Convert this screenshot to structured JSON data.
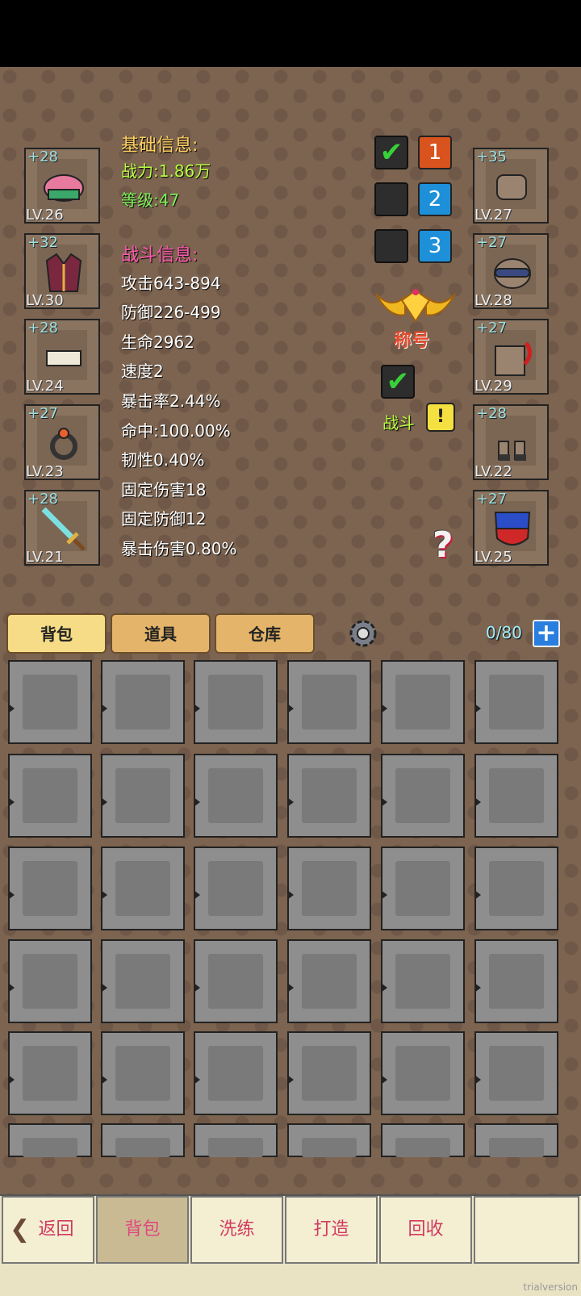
{
  "left_equipment": [
    {
      "plus": "+28",
      "level": "LV.26",
      "item_icon": "helmet-icon"
    },
    {
      "plus": "+32",
      "level": "LV.30",
      "item_icon": "armor-icon"
    },
    {
      "plus": "+28",
      "level": "LV.24",
      "item_icon": "skirt-icon"
    },
    {
      "plus": "+27",
      "level": "LV.23",
      "item_icon": "ring-icon"
    },
    {
      "plus": "+28",
      "level": "LV.21",
      "item_icon": "sword-icon"
    }
  ],
  "right_equipment": [
    {
      "plus": "+35",
      "level": "LV.27",
      "item_icon": "gloves-icon"
    },
    {
      "plus": "+27",
      "level": "LV.28",
      "item_icon": "mask-icon"
    },
    {
      "plus": "+27",
      "level": "LV.29",
      "item_icon": "cape-icon"
    },
    {
      "plus": "+28",
      "level": "LV.22",
      "item_icon": "boots-icon"
    },
    {
      "plus": "+27",
      "level": "LV.25",
      "item_icon": "shield-icon"
    }
  ],
  "basic_info": {
    "header": "基础信息:",
    "power": "战力:1.86万",
    "level": "等级:47"
  },
  "battle_info": {
    "header": "战斗信息:",
    "stats": [
      "攻击643-894",
      "防御226-499",
      "生命2962",
      "速度2",
      "暴击率2.44%",
      "命中:100.00%",
      "韧性0.40%",
      "固定伤害18",
      "固定防御12",
      "暴击伤害0.80%"
    ]
  },
  "presets": [
    {
      "number": "1",
      "checked": true,
      "color": "#d9531e"
    },
    {
      "number": "2",
      "checked": false,
      "color": "#1e90d9"
    },
    {
      "number": "3",
      "checked": false,
      "color": "#1e90d9"
    }
  ],
  "title_badge": {
    "label": "称号"
  },
  "battle_toggle": {
    "label": "战斗",
    "checked": true,
    "alert": "!"
  },
  "help_icon": "?",
  "tabs": [
    {
      "label": "背包",
      "active": true
    },
    {
      "label": "道具",
      "active": false
    },
    {
      "label": "仓库",
      "active": false
    }
  ],
  "capacity": "0/80",
  "bottom_nav": [
    {
      "label": "返回"
    },
    {
      "label": "背包",
      "active": true
    },
    {
      "label": "洗练"
    },
    {
      "label": "打造"
    },
    {
      "label": "回收"
    },
    {
      "label": ""
    }
  ],
  "watermark": "trialversion"
}
